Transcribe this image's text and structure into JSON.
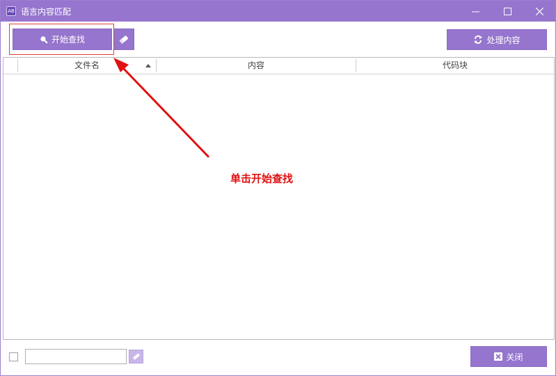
{
  "window": {
    "title": "语言内容匹配",
    "app_icon_text": "AB"
  },
  "toolbar": {
    "search_label": "开始查找",
    "process_label": "处理内容"
  },
  "grid": {
    "columns": [
      "文件名",
      "内容",
      "代码块"
    ],
    "rows": []
  },
  "annotation": {
    "text": "单击开始查找",
    "color": "#e01010"
  },
  "footer": {
    "input_value": "",
    "close_label": "关闭"
  },
  "colors": {
    "accent": "#9575cd",
    "highlight": "#e53935"
  }
}
